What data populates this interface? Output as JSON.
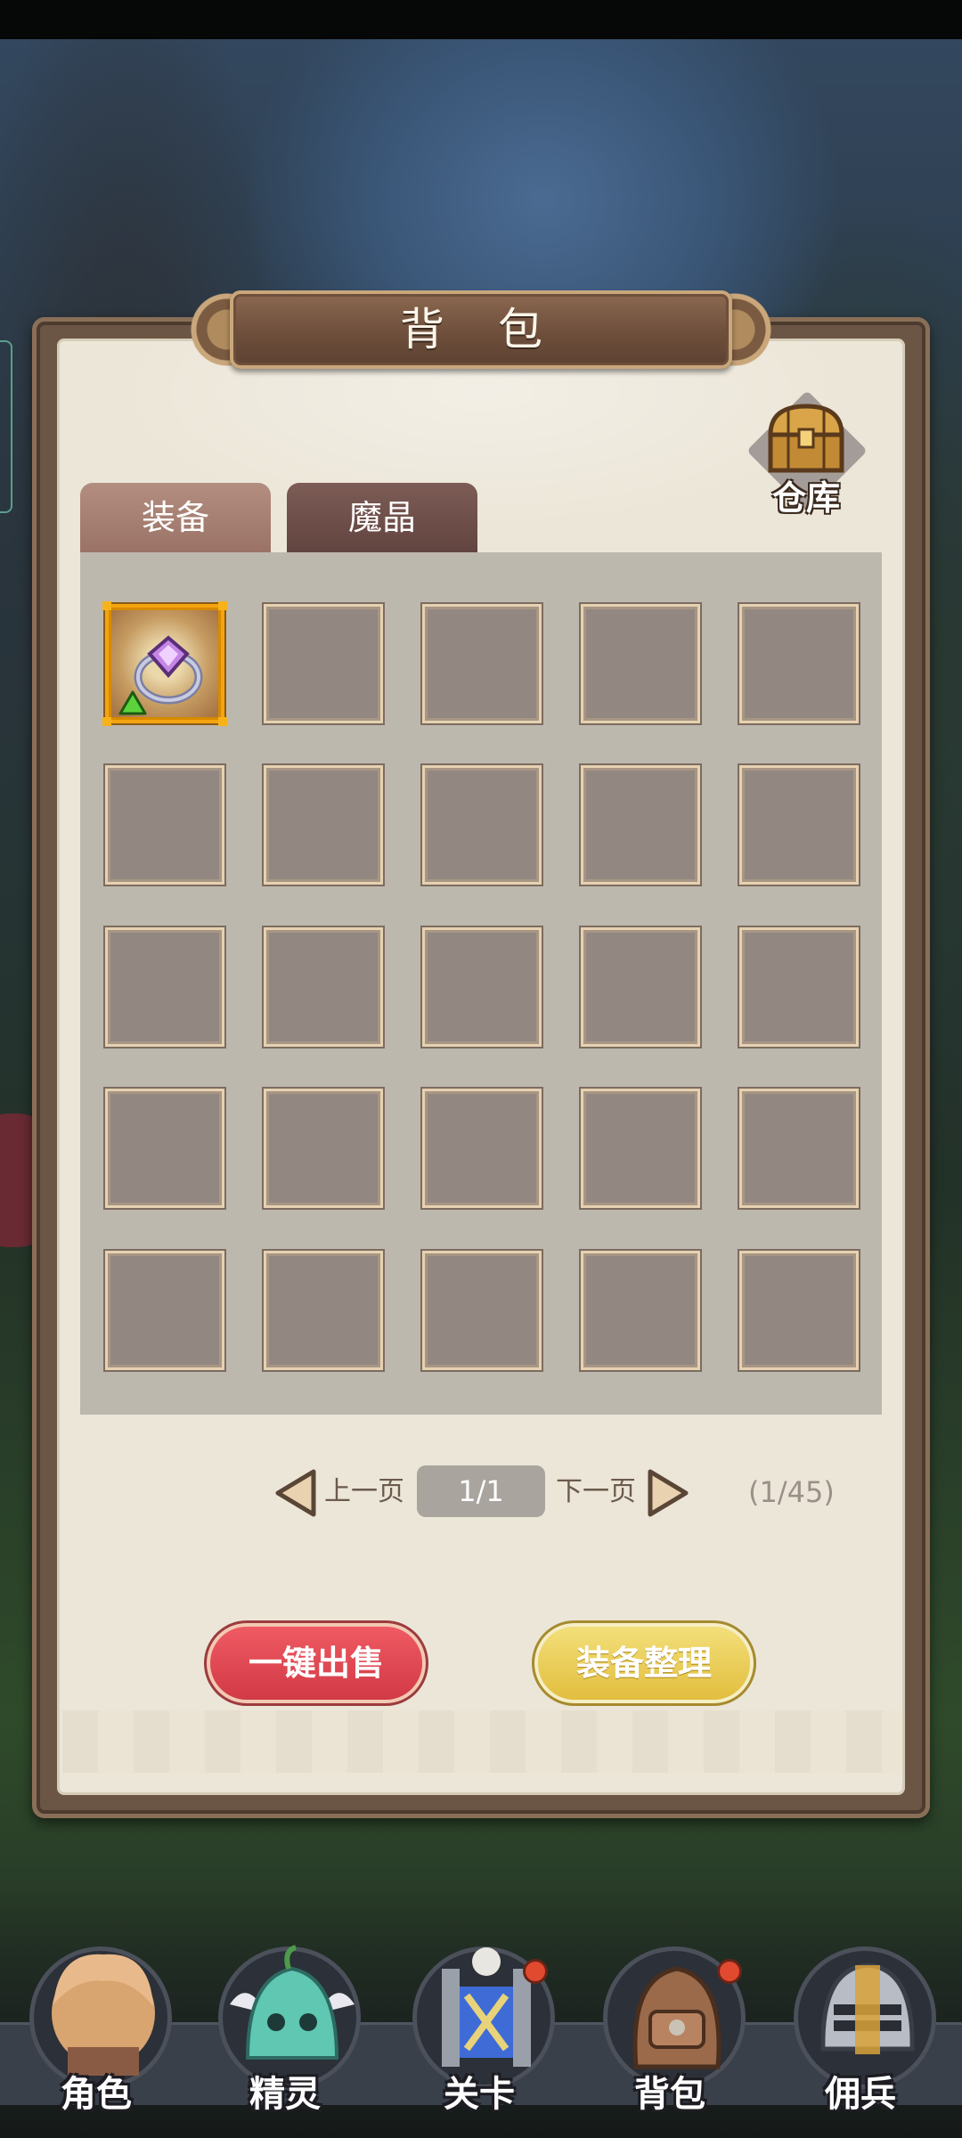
{
  "title": "背 包",
  "warehouse": {
    "label": "仓库"
  },
  "tabs": [
    {
      "label": "装备",
      "active": true
    },
    {
      "label": "魔晶",
      "active": false
    }
  ],
  "grid": {
    "rows": 5,
    "cols": 5,
    "items": [
      {
        "slot": 1,
        "icon": "amethyst-ring-icon",
        "upgrade_indicator": "green-up-arrow-icon",
        "frame_color": "#f3a40f"
      }
    ]
  },
  "pagination": {
    "prev_label": "上一页",
    "page": "1/1",
    "next_label": "下一页",
    "count": "(1/45)"
  },
  "actions": {
    "sell_all": "一键出售",
    "sort": "装备整理"
  },
  "bottom_nav": [
    {
      "label": "角色",
      "icon": "character-portrait-icon",
      "badge": false
    },
    {
      "label": "精灵",
      "icon": "slime-spirit-icon",
      "badge": false
    },
    {
      "label": "关卡",
      "icon": "stage-gate-icon",
      "badge": true
    },
    {
      "label": "背包",
      "icon": "backpack-icon",
      "badge": true
    },
    {
      "label": "佣兵",
      "icon": "knight-helmet-icon",
      "badge": false
    }
  ],
  "colors": {
    "sell_button": "#e2464f",
    "sort_button": "#eacb55",
    "selected_slot_frame": "#f3a40f"
  }
}
